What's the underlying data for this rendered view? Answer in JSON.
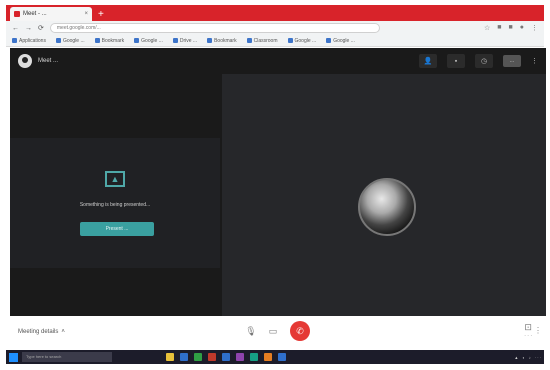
{
  "browser": {
    "tab_title": "Meet - ...",
    "new_tab": "+",
    "url": "meet.google.com/...",
    "bookmarks": [
      "Applications",
      "Google ...",
      "Bookmark",
      "Google ...",
      "Drive ...",
      "Bookmark",
      "Classroom",
      "Google ...",
      "Google ..."
    ]
  },
  "meet": {
    "title": "Meet ...",
    "header_pill": "...",
    "present_text": "Something is being presented...",
    "present_button": "Present ...",
    "details_label": "Meeting details"
  },
  "taskbar": {
    "search_placeholder": "Type here to search",
    "app_colors": [
      "#e8c13a",
      "#2f6fcc",
      "#2f9e44",
      "#c0392b",
      "#2f6fcc",
      "#8e44ad",
      "#16a085",
      "#e67e22",
      "#2f6fcc"
    ]
  }
}
